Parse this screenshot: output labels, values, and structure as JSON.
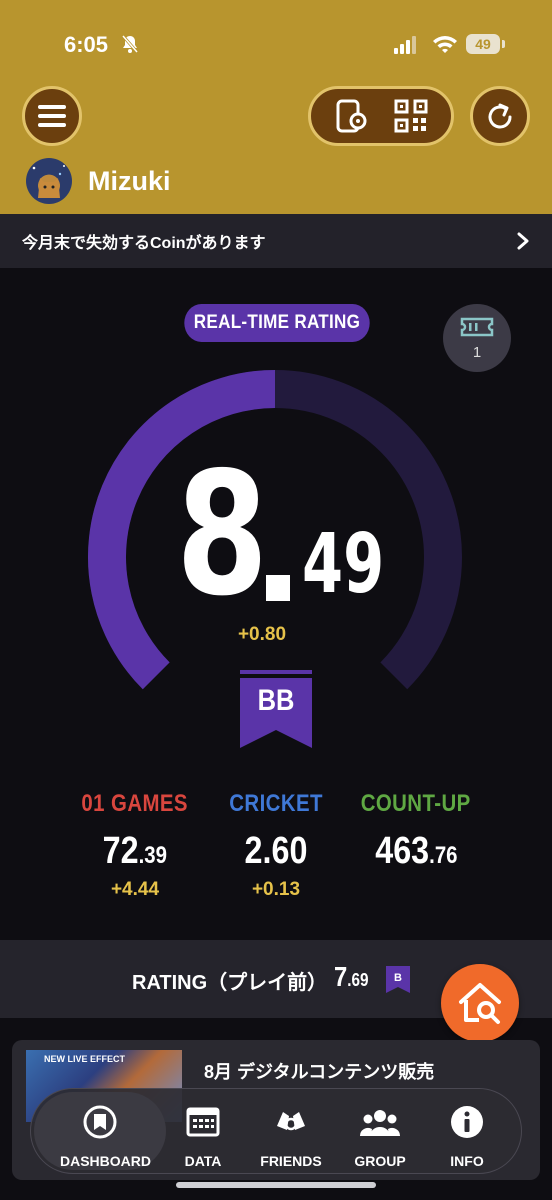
{
  "status_bar": {
    "time": "6:05",
    "battery": "49"
  },
  "header": {
    "username": "Mizuki"
  },
  "notice": {
    "text": "今月末で失効するCoinがあります"
  },
  "rating": {
    "badge_label": "REAL-TIME RATING",
    "ticket_count": "1",
    "integer": "8",
    "decimal": "49",
    "delta": "+0.80",
    "class_label": "BB",
    "gauge_fraction": 0.5,
    "colors": {
      "accent": "#5a34a8",
      "track": "#221a3d",
      "delta": "#e6c24a"
    }
  },
  "stats": [
    {
      "label": "01 GAMES",
      "int": "72",
      "dec": ".39",
      "delta": "+4.44",
      "color": "#d9463e"
    },
    {
      "label": "CRICKET",
      "int": "2.60",
      "dec": "",
      "delta": "+0.13",
      "color": "#3f78d6"
    },
    {
      "label": "COUNT-UP",
      "int": "463",
      "dec": ".76",
      "delta": "",
      "color": "#5fa843"
    }
  ],
  "pre_rating": {
    "label": "RATING（プレイ前）",
    "int": "7",
    "dec": ".69",
    "class_label": "B"
  },
  "banner": {
    "image_label": "NEW LIVE EFFECT",
    "title": "8月 デジタルコンテンツ販売"
  },
  "nav": [
    {
      "label": "DASHBOARD",
      "icon": "dashboard-icon"
    },
    {
      "label": "DATA",
      "icon": "calendar-icon"
    },
    {
      "label": "FRIENDS",
      "icon": "friends-icon"
    },
    {
      "label": "GROUP",
      "icon": "group-icon"
    },
    {
      "label": "INFO",
      "icon": "info-icon"
    }
  ]
}
